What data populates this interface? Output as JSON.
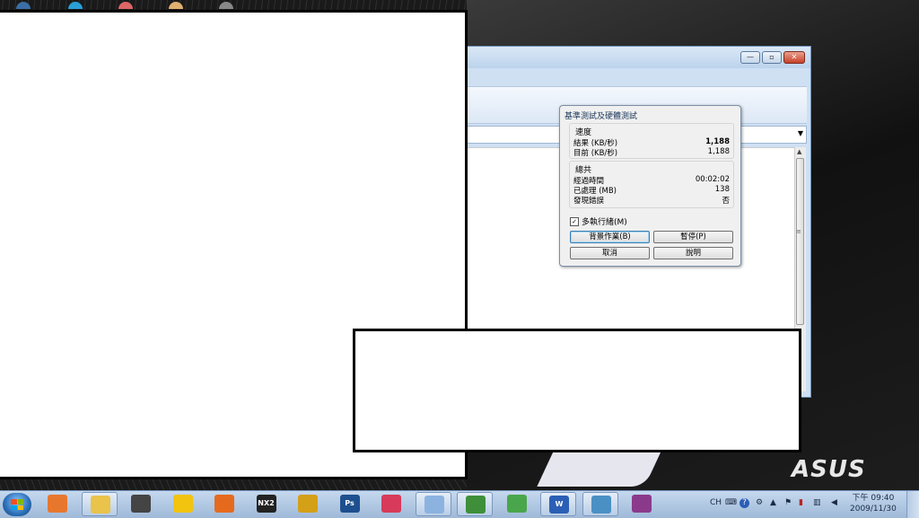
{
  "dialog": {
    "title": "基準測試及硬體測試",
    "speed_group": {
      "title": "速度",
      "result_label": "結果 (KB/秒)",
      "result_value": "1,188",
      "current_label": "目前 (KB/秒)",
      "current_value": "1,188"
    },
    "total_group": {
      "title": "總共",
      "elapsed_label": "經過時間",
      "elapsed_value": "00:02:02",
      "processed_label": "已處理 (MB)",
      "processed_value": "138",
      "errors_label": "發現錯誤",
      "errors_value": "否"
    },
    "multithread_label": "多執行緒(M)",
    "multithread_checked": true,
    "buttons": {
      "background": "背景作業(B)",
      "pause": "暫停(P)",
      "cancel": "取消",
      "help": "說明"
    }
  },
  "window_controls": {
    "minimize": "—",
    "maximize": "▫",
    "close": "✕"
  },
  "taskbar": {
    "apps": [
      {
        "name": "media-player-icon",
        "color": "#e8772e"
      },
      {
        "name": "file-explorer-icon",
        "color": "#e9c34a"
      },
      {
        "name": "alien-app-icon",
        "color": "#444444"
      },
      {
        "name": "yellow-app-icon",
        "color": "#f2c40f"
      },
      {
        "name": "firefox-icon",
        "color": "#e66a1d"
      },
      {
        "name": "nx2-icon",
        "color": "#222222",
        "text": "NX2"
      },
      {
        "name": "window-grid-app-icon",
        "color": "#d4a017"
      },
      {
        "name": "photoshop-icon",
        "color": "#1d4f8f",
        "text": "Ps"
      },
      {
        "name": "red-app-icon",
        "color": "#d73a5a"
      },
      {
        "name": "paint-icon",
        "color": "#8cb3e0"
      },
      {
        "name": "hardware-app-icon",
        "color": "#3f8f3a"
      },
      {
        "name": "messenger-icon",
        "color": "#4aa64a"
      },
      {
        "name": "word-icon",
        "color": "#2b5fb5",
        "text": "W"
      },
      {
        "name": "picture-viewer-icon",
        "color": "#4a90c4"
      },
      {
        "name": "winrar-icon",
        "color": "#8b3a8b"
      }
    ],
    "tray": {
      "language": "CH",
      "time": "下午 09:40",
      "date": "2009/11/30"
    }
  },
  "brand": "ASUS"
}
